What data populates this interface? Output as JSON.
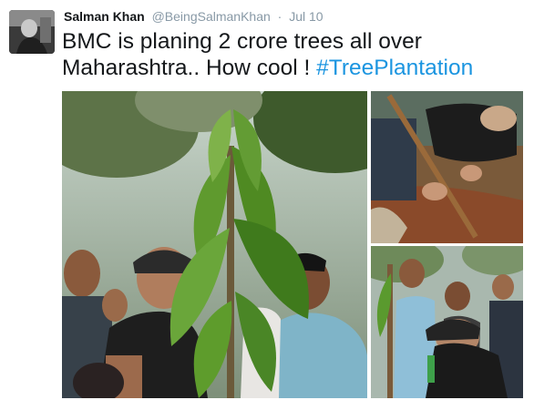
{
  "tweet": {
    "author_name": "Salman Khan",
    "author_handle": "@BeingSalmanKhan",
    "separator": "·",
    "date": "Jul 10",
    "text": "BMC is planing 2 crore trees all over Maharashtra.. How cool ! ",
    "hashtag": "#TreePlantation"
  },
  "colors": {
    "hashtag": "#1b95e0",
    "meta": "#8899a6",
    "text": "#14171a"
  },
  "icons": [
    "avatar-photo",
    "tree-planting-photo"
  ]
}
